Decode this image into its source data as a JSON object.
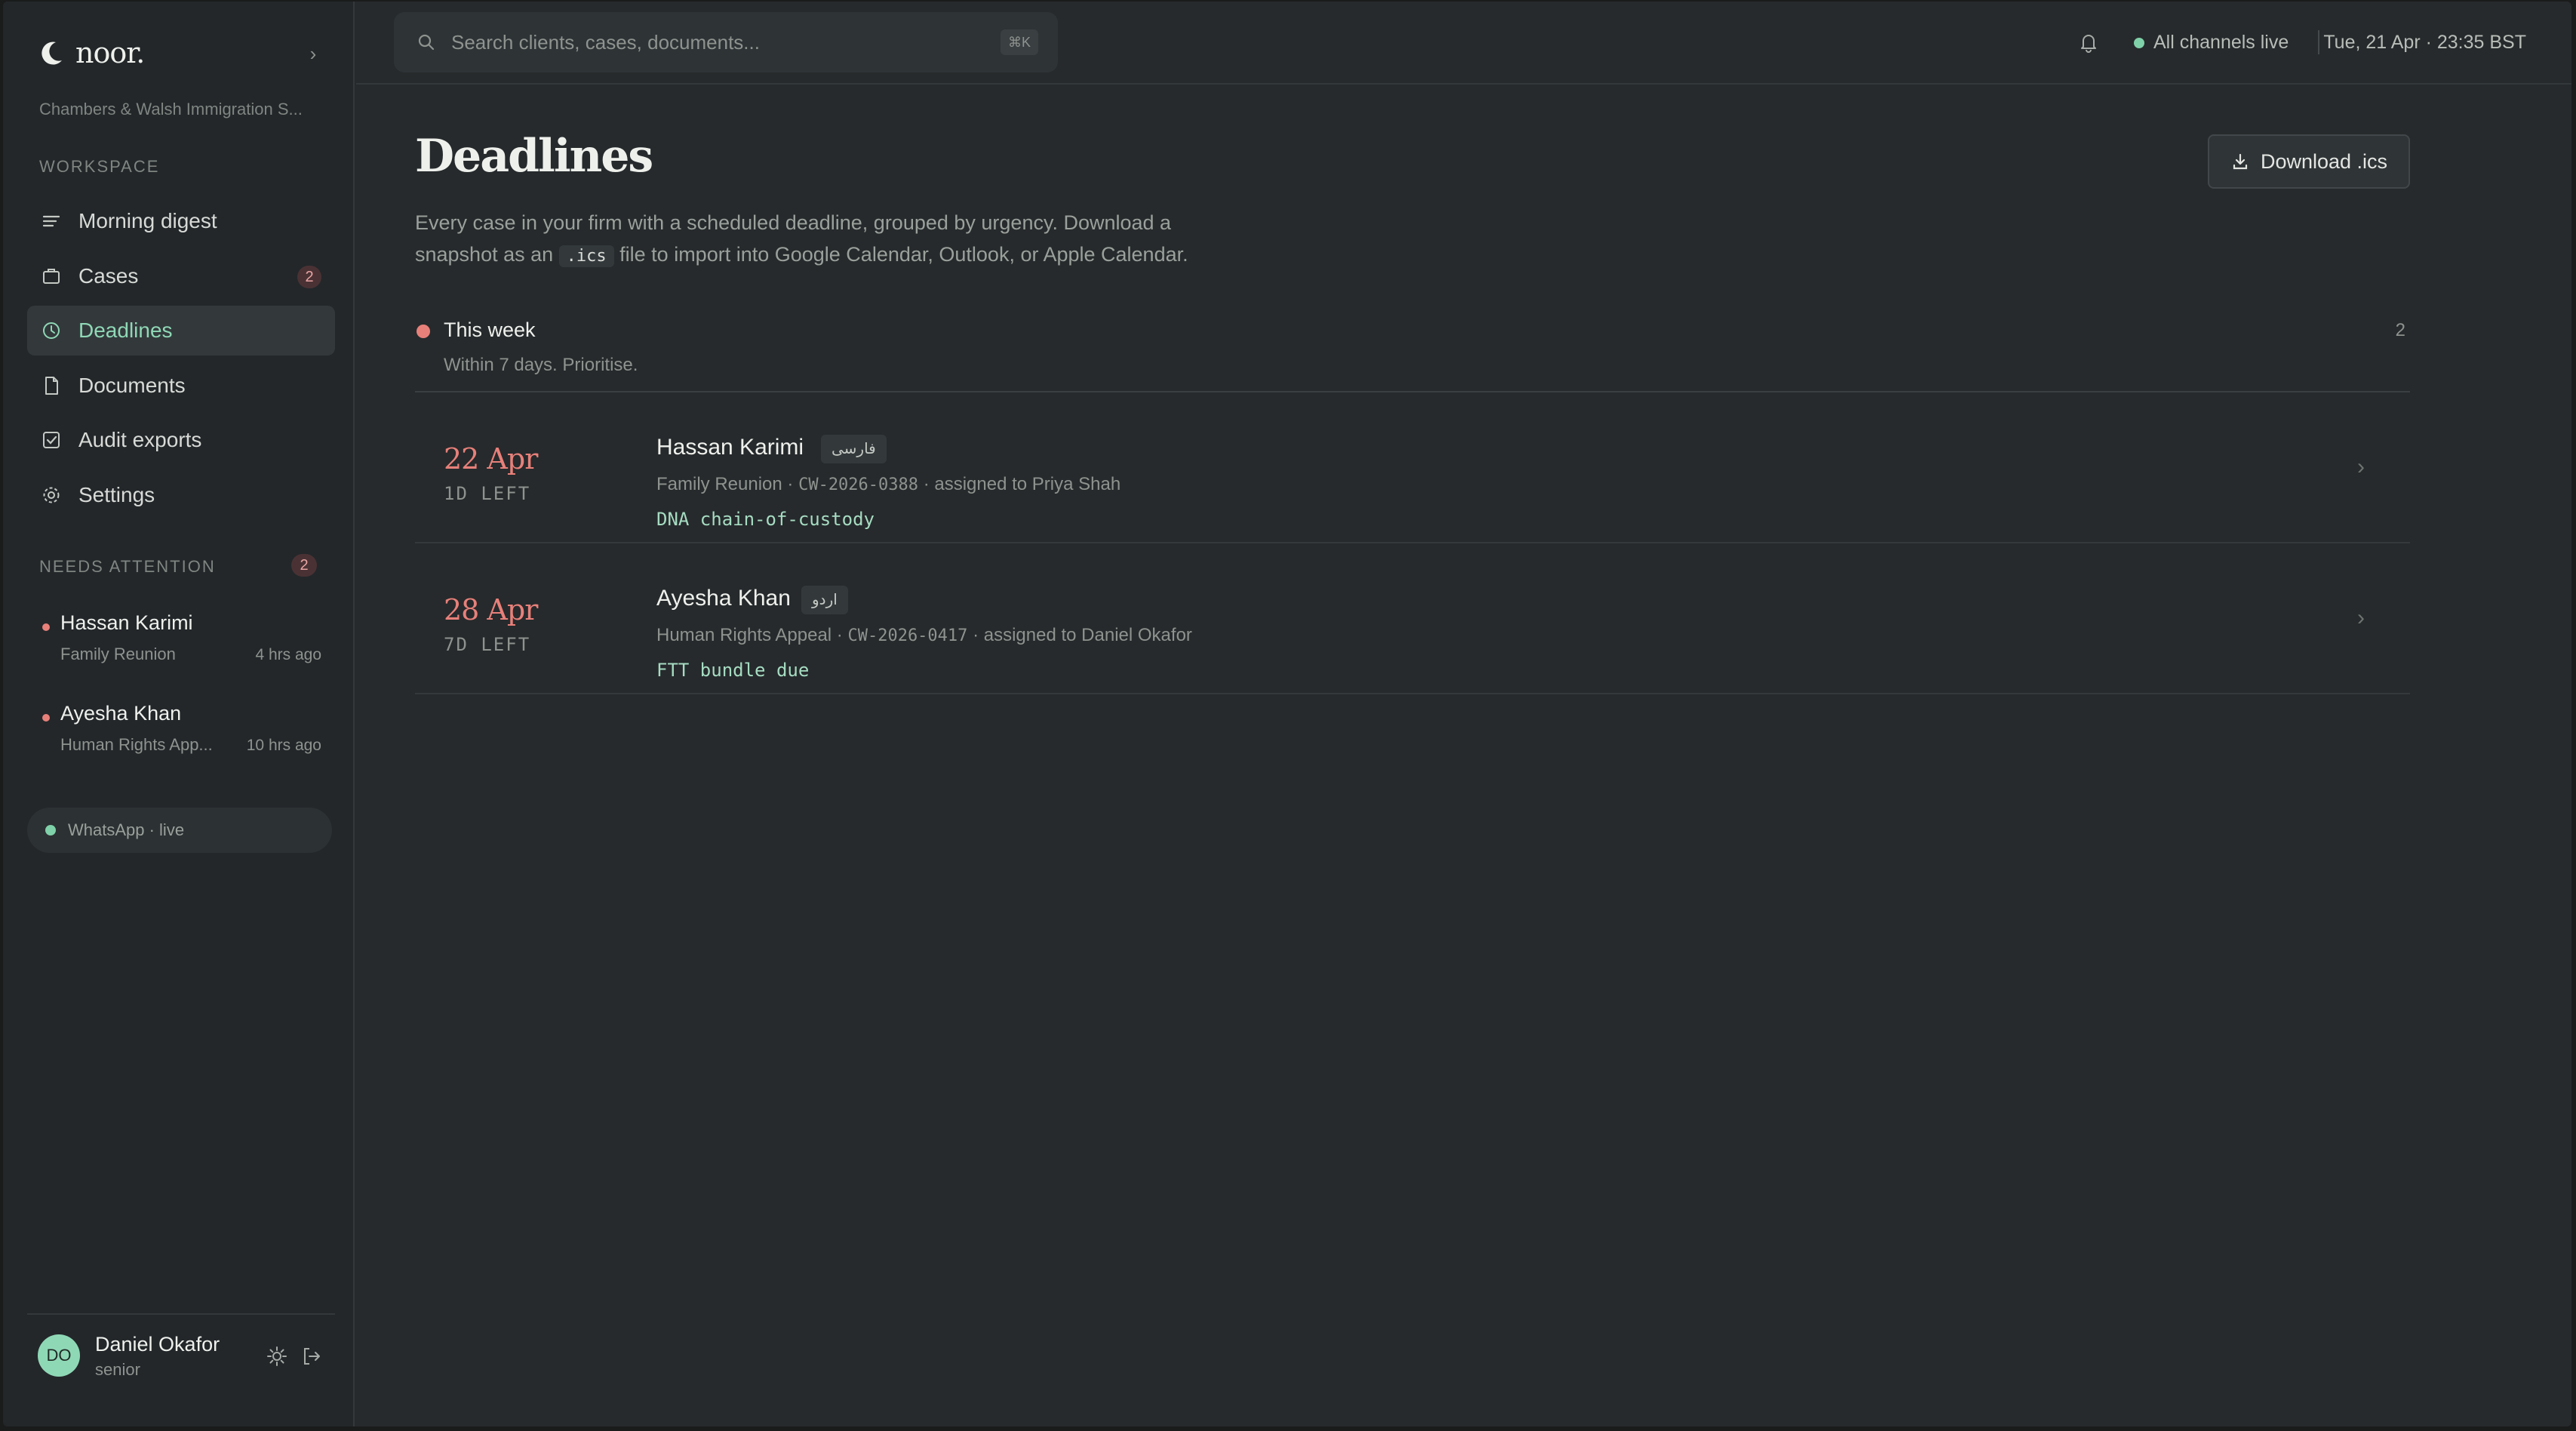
{
  "brand": {
    "name": "noor.",
    "firm": "Chambers & Walsh Immigration S..."
  },
  "sidebar": {
    "workspace_label": "WORKSPACE",
    "items": [
      {
        "label": "Morning digest",
        "icon": "lines-icon"
      },
      {
        "label": "Cases",
        "icon": "briefcase-icon",
        "badge": "2"
      },
      {
        "label": "Deadlines",
        "icon": "clock-icon",
        "active": true
      },
      {
        "label": "Documents",
        "icon": "document-icon"
      },
      {
        "label": "Audit exports",
        "icon": "checkbox-icon"
      },
      {
        "label": "Settings",
        "icon": "gear-icon"
      }
    ],
    "attention_label": "NEEDS ATTENTION",
    "attention_count": "2",
    "attention_items": [
      {
        "name": "Hassan Karimi",
        "sub": "Family Reunion",
        "time": "4 hrs ago"
      },
      {
        "name": "Ayesha Khan",
        "sub": "Human Rights App...",
        "time": "10 hrs ago"
      }
    ],
    "whatsapp_status": "WhatsApp · live",
    "user": {
      "initials": "DO",
      "name": "Daniel Okafor",
      "role": "senior"
    }
  },
  "topbar": {
    "search_placeholder": "Search clients, cases, documents...",
    "shortcut": "⌘K",
    "channels_status": "All channels live",
    "datetime": "Tue, 21 Apr · 23:35 BST"
  },
  "main": {
    "title": "Deadlines",
    "desc_before": "Every case in your firm with a scheduled deadline, grouped by urgency. Download a snapshot as an",
    "desc_code": ".ics",
    "desc_after": "file to import into Google Calendar, Outlook, or Apple Calendar.",
    "download_label": "Download .ics",
    "group": {
      "title": "This week",
      "subtitle": "Within 7 days. Prioritise.",
      "count": "2"
    },
    "deadlines": [
      {
        "date": "22 Apr",
        "left": "1D LEFT",
        "name": "Hassan Karimi",
        "lang": "فارسی",
        "case_type": "Family Reunion ·",
        "case_id": "CW-2026-0388",
        "assigned": "· assigned to Priya Shah",
        "tag": "DNA chain-of-custody"
      },
      {
        "date": "28 Apr",
        "left": "7D LEFT",
        "name": "Ayesha Khan",
        "lang": "اردو",
        "case_type": "Human Rights Appeal ·",
        "case_id": "CW-2026-0417",
        "assigned": "· assigned to Daniel Okafor",
        "tag": "FTT bundle due"
      }
    ]
  },
  "colors": {
    "accent": "#8fd8b6",
    "urgent": "#e8807a",
    "background": "#262a2c"
  }
}
